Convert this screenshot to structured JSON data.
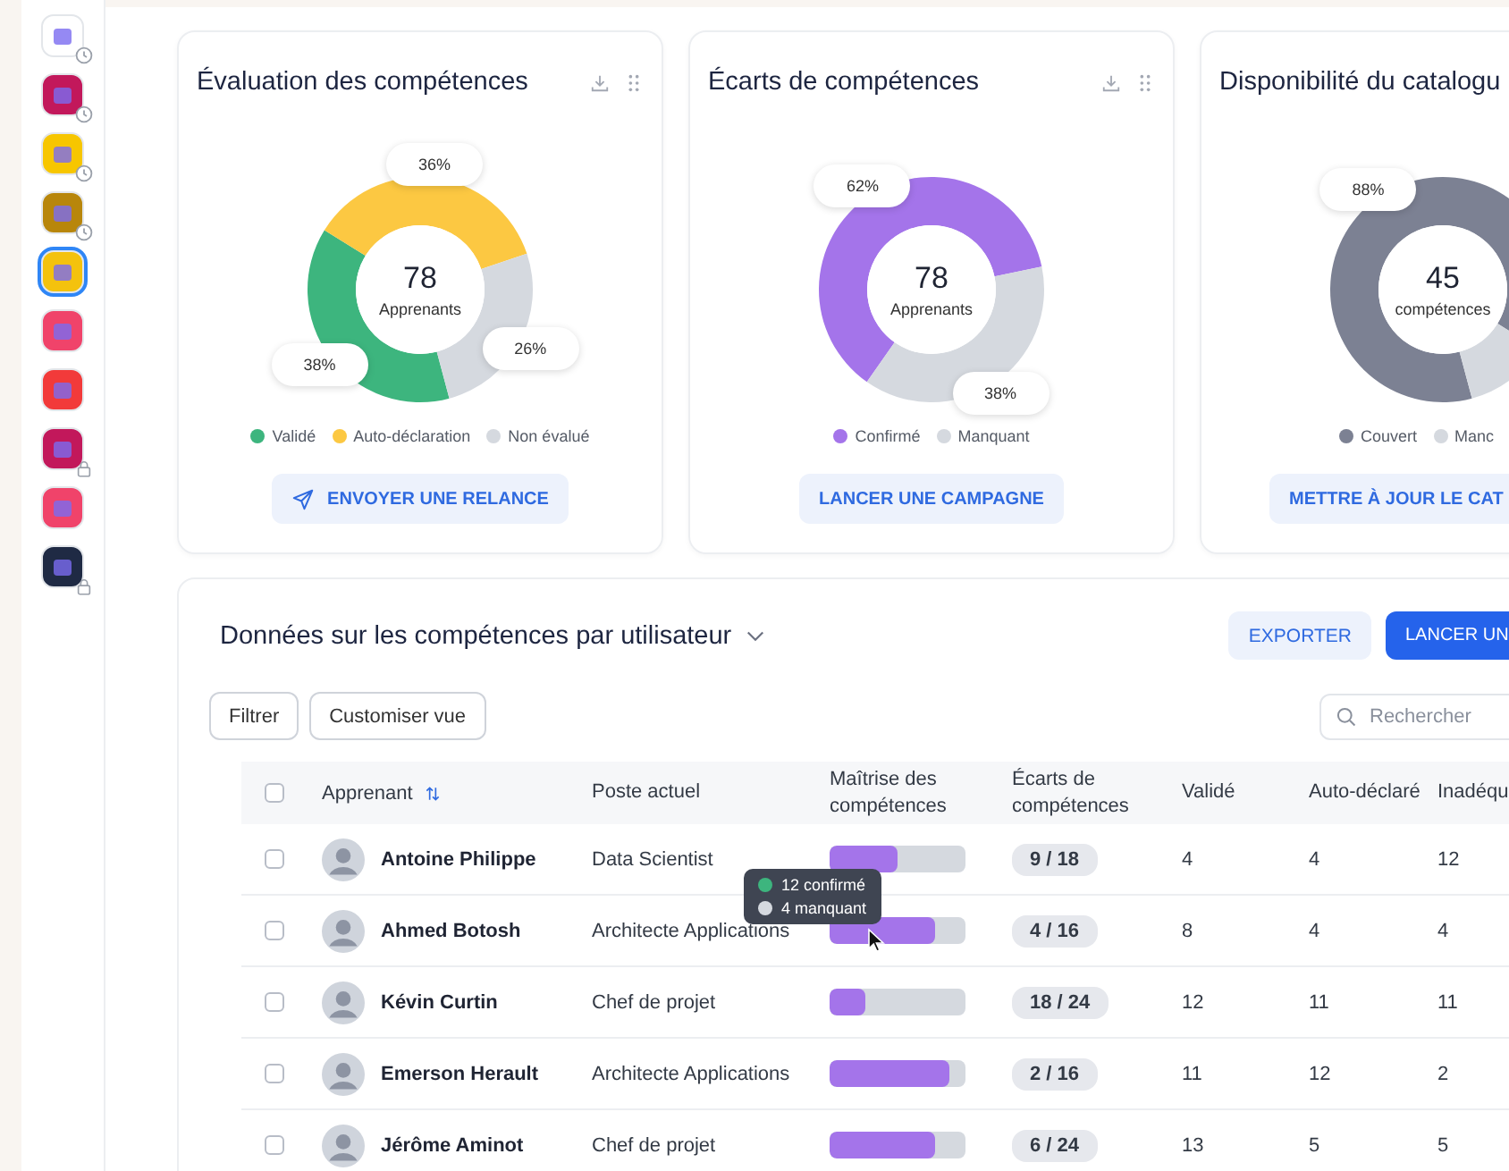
{
  "sidebar": {
    "items": [
      {
        "color": "#ffffff",
        "kind": "clock",
        "selected": false
      },
      {
        "color": "#c2185b",
        "kind": "clock",
        "selected": false
      },
      {
        "color": "#f7c600",
        "kind": "clock",
        "selected": false
      },
      {
        "color": "#b8860b",
        "kind": "clock",
        "selected": false
      },
      {
        "color": "#f4c20d",
        "kind": "plain",
        "selected": true
      },
      {
        "color": "#f0436a",
        "kind": "plain",
        "selected": false
      },
      {
        "color": "#f23a3a",
        "kind": "plain",
        "selected": false
      },
      {
        "color": "#c2185b",
        "kind": "lock",
        "selected": false
      },
      {
        "color": "#f0436a",
        "kind": "plain",
        "selected": false
      },
      {
        "color": "#1f2a44",
        "kind": "lock",
        "selected": false
      }
    ]
  },
  "cards": [
    {
      "title": "Évaluation des compétences",
      "center_value": "78",
      "center_label": "Apprenants",
      "chart_data": {
        "type": "donut",
        "categories": [
          "Validé",
          "Auto-déclaration",
          "Non évalué"
        ],
        "values": [
          38,
          36,
          26
        ],
        "value_labels": [
          "38%",
          "36%",
          "26%"
        ]
      },
      "legend": [
        {
          "color": "#3db57e"
        },
        {
          "color": "#fcc842"
        },
        {
          "color": "#d5d9df"
        }
      ],
      "button": {
        "label": "ENVOYER UNE RELANCE",
        "kind": "send"
      }
    },
    {
      "title": "Écarts de compétences",
      "center_value": "78",
      "center_label": "Apprenants",
      "chart_data": {
        "type": "donut",
        "categories": [
          "Confirmé",
          "Manquant"
        ],
        "values": [
          62,
          38
        ],
        "value_labels": [
          "62%",
          "38%"
        ]
      },
      "legend": [
        {
          "color": "#a474ea"
        },
        {
          "color": "#d5d9df"
        }
      ],
      "button": {
        "label": "LANCER UNE CAMPAGNE",
        "kind": "plain"
      }
    },
    {
      "title": "Disponibilité du catalogu",
      "center_value": "45",
      "center_label": "compétences",
      "chart_data": {
        "type": "donut",
        "categories": [
          "Couvert",
          "Manc"
        ],
        "values": [
          88,
          12
        ],
        "value_labels": [
          "88%",
          null
        ]
      },
      "legend": [
        {
          "color": "#7c8193"
        },
        {
          "color": "#d5d9df"
        }
      ],
      "button": {
        "label": "METTRE À JOUR LE CAT",
        "kind": "plain"
      }
    }
  ],
  "table_section": {
    "title": "Données sur les compétences par utilisateur",
    "export_button": "EXPORTER",
    "primary_button": "LANCER UN",
    "filter_button": "Filtrer",
    "customize_button": "Customiser vue",
    "search": {
      "placeholder": "Rechercher"
    },
    "select_all_checked": false,
    "columns": [
      "Apprenant",
      "Poste actuel",
      "Maîtrise des compétences",
      "Écarts de compétences",
      "Validé",
      "Auto-déclaré",
      "Inadéqu"
    ],
    "rows": [
      {
        "checked": false,
        "name": "Antoine Philippe",
        "role": "Data Scientist",
        "level": 0.5,
        "gap": "9 / 18",
        "validated": "4",
        "self_declared": "4",
        "column_8": "12"
      },
      {
        "checked": false,
        "name": "Ahmed Botosh",
        "role": "Architecte Applications",
        "level": 0.78,
        "gap": "4 / 16",
        "validated": "8",
        "self_declared": "4",
        "column_8": "4"
      },
      {
        "checked": false,
        "name": "Kévin Curtin",
        "role": "Chef de projet",
        "level": 0.26,
        "gap": "18 / 24",
        "validated": "12",
        "self_declared": "11",
        "column_8": "11"
      },
      {
        "checked": false,
        "name": "Emerson Herault",
        "role": "Architecte Applications",
        "level": 0.88,
        "gap": "2 / 16",
        "validated": "11",
        "self_declared": "12",
        "column_8": "2"
      },
      {
        "checked": false,
        "name": "Jérôme Aminot",
        "role": "Chef de projet",
        "level": 0.78,
        "gap": "6 / 24",
        "validated": "13",
        "self_declared": "5",
        "column_8": "5"
      }
    ],
    "tooltip": {
      "items": [
        {
          "label": "12 confirmé",
          "color": "#3db57e"
        },
        {
          "label": "4 manquant",
          "color": "#d5d9df"
        }
      ]
    }
  }
}
